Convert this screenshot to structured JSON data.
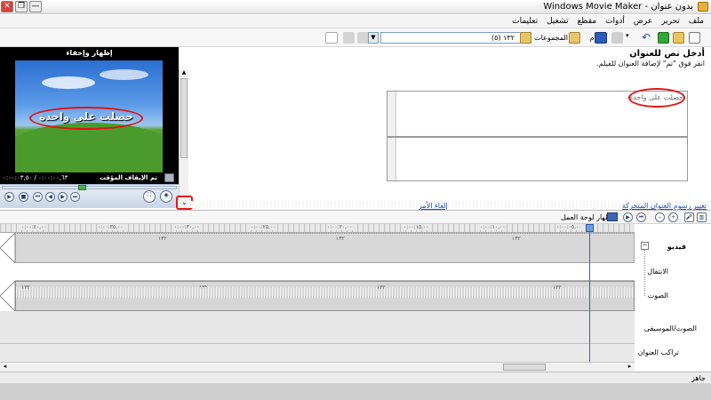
{
  "window": {
    "title": "بدون عنوان - Windows Movie Maker",
    "close_glyph": "✕",
    "restore_glyph": "❐",
    "minimize_glyph": "—"
  },
  "menu": {
    "items": [
      "ملف",
      "تحرير",
      "عرض",
      "أدوات",
      "مقطع",
      "تشغيل",
      "تعليمات"
    ]
  },
  "toolbar": {
    "tasks_label": "مهام",
    "collections_label": "المجموعات",
    "collections_value": "١٣٢ (٥)"
  },
  "preview": {
    "header": "إظهار وإخفاء",
    "overlay_text": "حصلت على واحدة",
    "status": "تم الإيقاف المؤقت",
    "time": "٠:٠٠:٠٠,٦٣ / ٠:٠٠:٠٣,٥٠"
  },
  "title_entry": {
    "heading": "أدخل نص للعنوان",
    "description": "انقر فوق \"تم\" لإضافة العنوان للفيلم.",
    "text_value": "حصلت على واحدة",
    "cancel_link": "إلغاء الأمر",
    "more_options_link": "تغيير رسوم العنوان المتحركة"
  },
  "timeline": {
    "view_label": "إظهار لوحة العمل",
    "ruler_labels": [
      "٠:٠٠:٤٠,٠٠",
      "٠:٠٠:٣٥,٠٠",
      "٠:٠٠:٣٠,٠٠",
      "٠:٠٠:٢٥,٠٠",
      "٠:٠٠:٢٠,٠٠",
      "٠:٠٠:١٥,٠٠",
      "٠:٠٠:١٠,٠٠",
      "٠:٠٠:٠٥,٠٠"
    ],
    "clip_label": "١٣٢",
    "tracks": {
      "video": "فيديو",
      "transition": "الانتقال",
      "audio": "الصوت",
      "music": "الصوت/الموسيقى",
      "title_overlay": "تراكب العنوان"
    },
    "collapse_glyph": "−"
  },
  "status": {
    "text": "جاهز"
  },
  "colors": {
    "highlight_red": "#e31212",
    "playhead_blue": "#2e64b8",
    "link_blue": "#1f4fbf"
  }
}
